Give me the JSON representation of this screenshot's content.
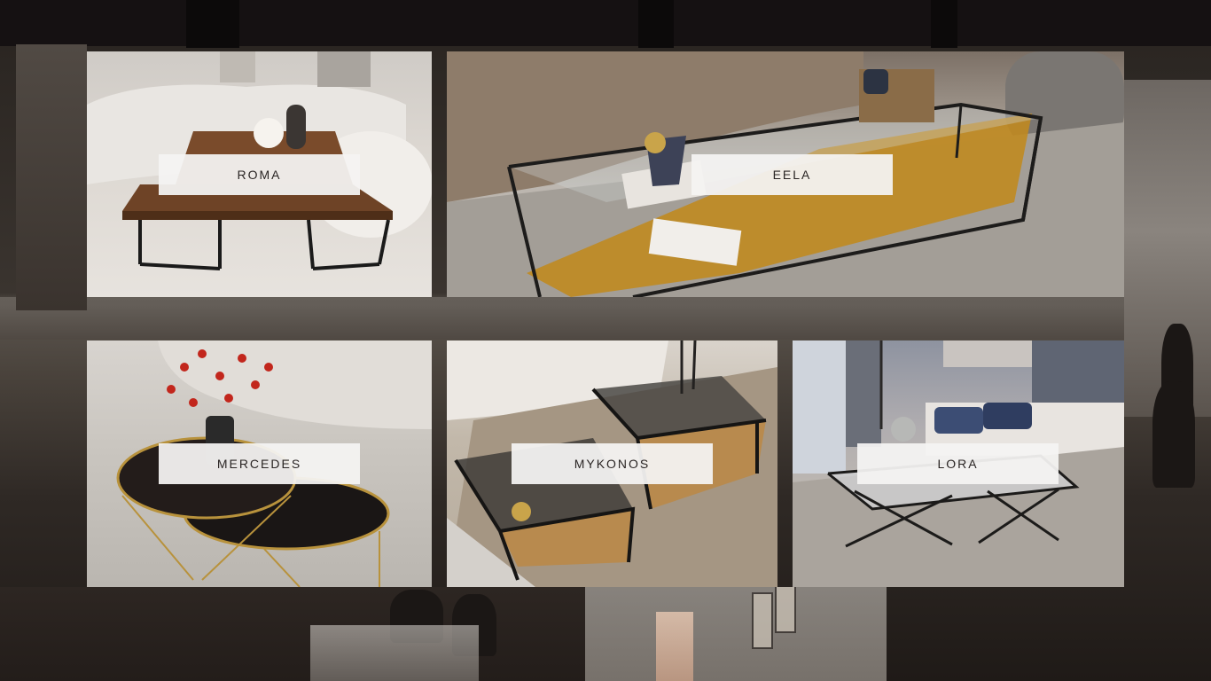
{
  "products": [
    {
      "name": "ROMA"
    },
    {
      "name": "EELA"
    },
    {
      "name": "MERCEDES"
    },
    {
      "name": "MYKONOS"
    },
    {
      "name": "LORA"
    }
  ],
  "colors": {
    "caption_bg": "#f4f3f2",
    "caption_text": "#2a2524",
    "page_bg": "#141010"
  }
}
